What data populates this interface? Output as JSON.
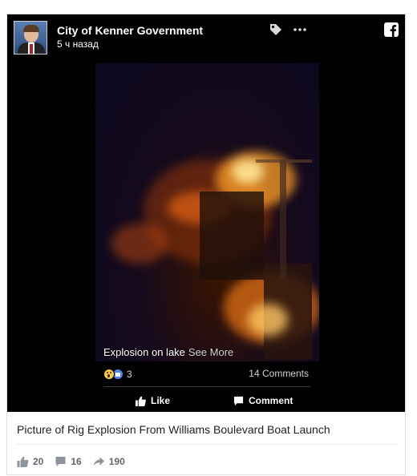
{
  "post": {
    "page_name": "City of Kenner Government",
    "time": "5 ч назад",
    "video_title": "Explosion on lake",
    "see_more": "See More",
    "reaction_count": "3",
    "comments_count": "14 Comments",
    "like_label": "Like",
    "comment_label": "Comment",
    "description": "Picture of Rig Explosion From Williams Boulevard Boat Launch"
  },
  "stats": {
    "likes": "20",
    "comments": "16",
    "shares": "190"
  },
  "icons": {
    "tag": "tag-icon",
    "more": "more-icon",
    "facebook": "facebook-icon",
    "reaction_wow": "wow-reaction-icon",
    "reaction_like": "like-reaction-icon"
  },
  "colors": {
    "header_bg": "#000000",
    "card_border": "#dddfe2",
    "muted_text": "#606770",
    "facebook_blue": "#4a86e8"
  }
}
